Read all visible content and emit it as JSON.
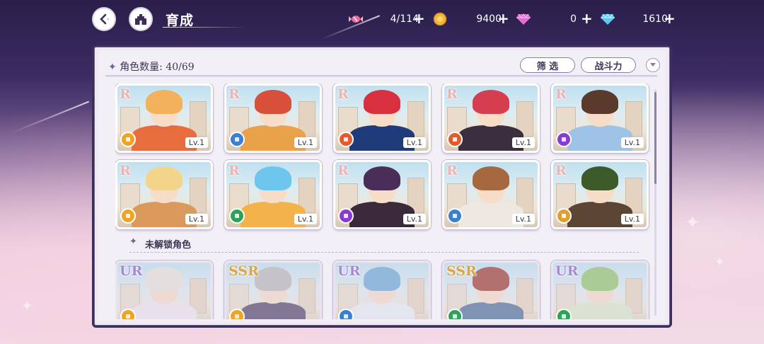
{
  "topbar": {
    "title": "育成",
    "resources": [
      {
        "icon": "candy-icon",
        "value": "4/114"
      },
      {
        "icon": "gold-coin-icon",
        "value": "9400"
      },
      {
        "icon": "pink-diamond-icon",
        "value": "0"
      },
      {
        "icon": "blue-diamond-icon",
        "value": "1610"
      }
    ]
  },
  "panel": {
    "count_label": "角色数量: 40/69",
    "filter_label": "筛 选",
    "sort_label": "战斗力",
    "unlocked_section_label": "未解锁角色"
  },
  "cards_unlocked": [
    {
      "rarity": "R",
      "level": "Lv.1",
      "element_color": "#f0a424",
      "hair": "#f2b15a",
      "body": "#e76d3e"
    },
    {
      "rarity": "R",
      "level": "Lv.1",
      "element_color": "#3b7fd0",
      "hair": "#d9503a",
      "body": "#e9a24a"
    },
    {
      "rarity": "R",
      "level": "Lv.1",
      "element_color": "#e25b2e",
      "hair": "#d8303e",
      "body": "#1f3b7a"
    },
    {
      "rarity": "R",
      "level": "Lv.1",
      "element_color": "#e25b2e",
      "hair": "#d63d4f",
      "body": "#3a2e3f"
    },
    {
      "rarity": "R",
      "level": "Lv.1",
      "element_color": "#8a3ad1",
      "hair": "#5a3a2a",
      "body": "#9fc3e6"
    },
    {
      "rarity": "R",
      "level": "Lv.1",
      "element_color": "#f0a424",
      "hair": "#f3d58a",
      "body": "#d99a5b"
    },
    {
      "rarity": "R",
      "level": "Lv.1",
      "element_color": "#2fa25a",
      "hair": "#6ec6ef",
      "body": "#f3b34a"
    },
    {
      "rarity": "R",
      "level": "Lv.1",
      "element_color": "#8a3ad1",
      "hair": "#4a2e57",
      "body": "#3a2a3c"
    },
    {
      "rarity": "R",
      "level": "Lv.1",
      "element_color": "#3b7fd0",
      "hair": "#a5683f",
      "body": "#efe8e2"
    },
    {
      "rarity": "R",
      "level": "Lv.1",
      "element_color": "#e0a030",
      "hair": "#3d5a2b",
      "body": "#5a4633"
    }
  ],
  "cards_locked": [
    {
      "rarity": "UR",
      "element_color": "#f0a424",
      "hair": "#e8e2dc",
      "body": "#ece6f0"
    },
    {
      "rarity": "SSR",
      "element_color": "#f0a424",
      "hair": "#b8b8b8",
      "body": "#51466a"
    },
    {
      "rarity": "UR",
      "element_color": "#3b7fd0",
      "hair": "#6aa8d8",
      "body": "#e9eef4"
    },
    {
      "rarity": "SSR",
      "element_color": "#2fa25a",
      "hair": "#9c3a2e",
      "body": "#4d6f9a"
    },
    {
      "rarity": "UR",
      "element_color": "#2fa25a",
      "hair": "#8fc56a",
      "body": "#d7e9c9"
    }
  ]
}
